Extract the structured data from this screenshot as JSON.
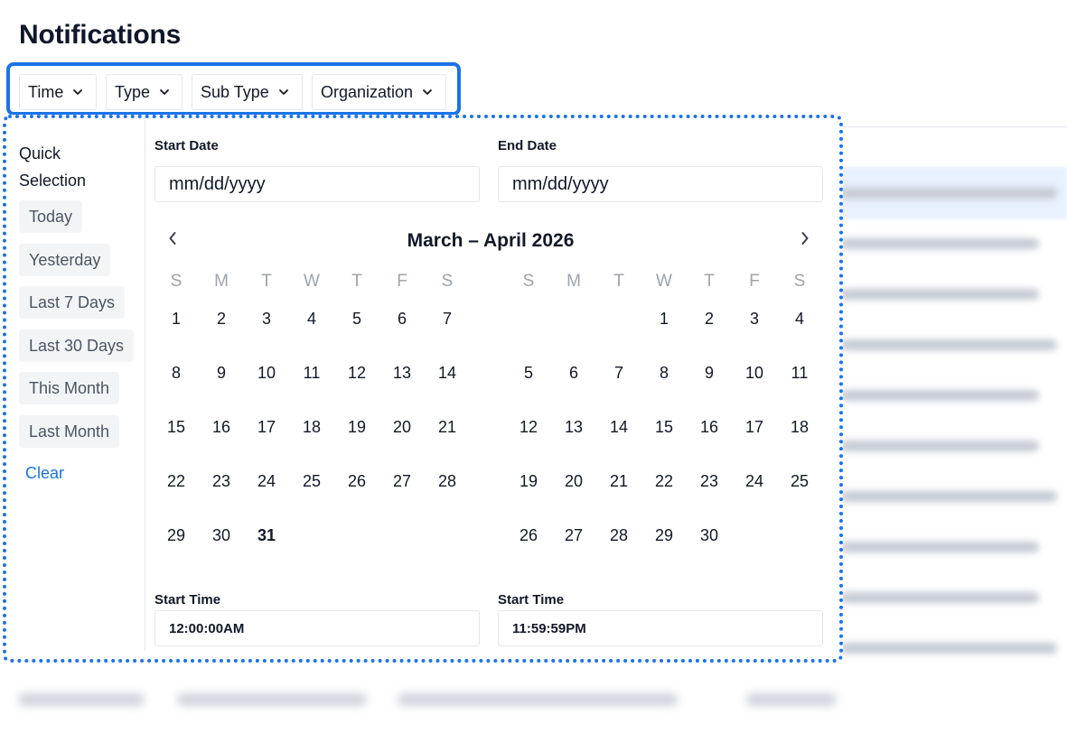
{
  "page": {
    "title": "Notifications"
  },
  "filters": [
    {
      "label": "Time",
      "icon": "chevron-down-icon"
    },
    {
      "label": "Type",
      "icon": "chevron-down-icon"
    },
    {
      "label": "Sub Type",
      "icon": "chevron-down-icon"
    },
    {
      "label": "Organization",
      "icon": "chevron-down-icon"
    }
  ],
  "quick_selection": {
    "title": "Quick Selection",
    "options": [
      "Today",
      "Yesterday",
      "Last 7 Days",
      "Last 30 Days",
      "This Month",
      "Last Month"
    ],
    "clear_label": "Clear"
  },
  "date_range": {
    "start_label": "Start Date",
    "start_placeholder": "mm/dd/yyyy",
    "end_label": "End Date",
    "end_placeholder": "mm/dd/yyyy",
    "month_title": "March – April 2026",
    "weekdays": [
      "S",
      "M",
      "T",
      "W",
      "T",
      "F",
      "S"
    ],
    "months": [
      {
        "name": "March 2026",
        "first_weekday": 0,
        "days": 31
      },
      {
        "name": "April 2026",
        "first_weekday": 3,
        "days": 30
      }
    ],
    "today": {
      "month": 0,
      "day": 31
    },
    "start_time_label": "Start Time",
    "start_time_value": "12:00:00AM",
    "end_time_label": "Start Time",
    "end_time_value": "11:59:59PM"
  },
  "colors": {
    "accent": "#1a73e8",
    "border": "#e5e7eb",
    "muted": "#9ca3af"
  }
}
